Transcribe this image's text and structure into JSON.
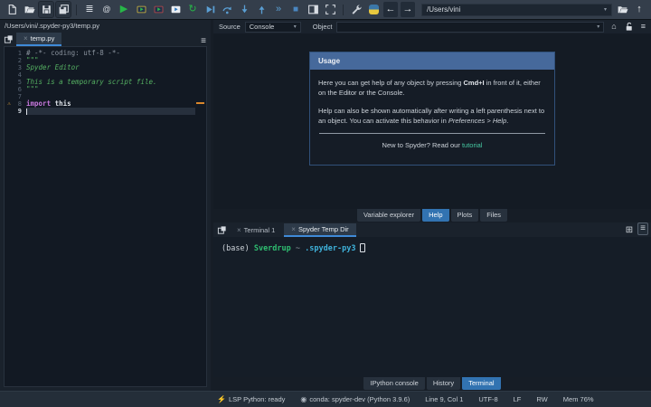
{
  "colors": {
    "accent_blue": "#3273b1",
    "tab_underline_blue": "#3f8ad8",
    "run_green": "#27b648",
    "debug_blue": "#5a9fd4",
    "warning_orange": "#e0a33b",
    "scrollflag_orange": "#d9862c",
    "link_green": "#45c6a0",
    "usage_header_blue": "#46699b",
    "string_green": "#55b062",
    "keyword_purple": "#c678dd"
  },
  "toolbar": {
    "buttons": [
      {
        "name": "new-file-button",
        "icon": "document-icon",
        "svg": "doc"
      },
      {
        "name": "open-file-button",
        "icon": "folder-open-icon",
        "svg": "folder"
      },
      {
        "name": "save-button",
        "icon": "save-icon",
        "svg": "save",
        "boxed": true
      },
      {
        "name": "save-all-button",
        "icon": "save-all-icon",
        "svg": "saveall",
        "boxed": true
      },
      {
        "separator": true
      },
      {
        "name": "outline-button",
        "icon": "outline-icon",
        "glyph": "≣",
        "color": "#d4d9df"
      },
      {
        "name": "find-symbol-button",
        "icon": "at-icon",
        "glyph": "@",
        "color": "#d4d9df",
        "size": "9px"
      },
      {
        "name": "run-file-button",
        "icon": "run-icon",
        "glyph": "▶",
        "color": "#27b648"
      },
      {
        "name": "run-cell-button",
        "icon": "run-cell-icon",
        "svg": "cell"
      },
      {
        "name": "run-cell-advance-button",
        "icon": "run-cell-advance-icon",
        "svg": "cellred"
      },
      {
        "name": "rerun-cell-button",
        "icon": "rerun-cell-icon",
        "svg": "rerun"
      },
      {
        "name": "run-selection-button",
        "icon": "run-selection-icon",
        "glyph": "↻",
        "color": "#27b648"
      },
      {
        "name": "debug-file-button",
        "icon": "debug-play-icon",
        "svg": "debugplay"
      },
      {
        "name": "step-over-button",
        "icon": "step-over-icon",
        "svg": "stepover"
      },
      {
        "name": "step-into-button",
        "icon": "step-into-icon",
        "svg": "stepinto"
      },
      {
        "name": "step-return-button",
        "icon": "step-return-icon",
        "svg": "stepreturn"
      },
      {
        "name": "continue-button",
        "icon": "continue-icon",
        "glyph": "»",
        "color": "#5a9fd4"
      },
      {
        "name": "stop-button",
        "icon": "stop-icon",
        "glyph": "■",
        "color": "#4a86c0",
        "size": "10px"
      },
      {
        "name": "panels-button",
        "icon": "panel-layout-icon",
        "svg": "panel"
      },
      {
        "name": "maximize-pane-button",
        "icon": "maximize-icon",
        "svg": "maximize"
      },
      {
        "separator": true
      },
      {
        "name": "preferences-button",
        "icon": "wrench-icon",
        "svg": "wrench"
      },
      {
        "name": "python-environment-button",
        "icon": "python-logo-icon",
        "svg": "python"
      },
      {
        "name": "back-button",
        "icon": "arrow-left-icon",
        "glyph": "←",
        "color": "#e8ebee",
        "dark": true
      },
      {
        "name": "forward-button",
        "icon": "arrow-right-icon",
        "glyph": "→",
        "color": "#e8ebee",
        "dark": true
      }
    ],
    "cwd_value": "/Users/vini",
    "chevron_glyph": "▾",
    "up_glyph": "↑"
  },
  "editor": {
    "path": "/Users/vini/.spyder-py3/temp.py",
    "tab_label": "temp.py",
    "close_glyph": "×",
    "menu_glyph": "≡",
    "warning_glyph": "⚠",
    "lines": [
      {
        "n": "1",
        "tokens": [
          {
            "t": "# -*- coding: utf-8 -*-",
            "c": "comment"
          }
        ]
      },
      {
        "n": "2",
        "tokens": [
          {
            "t": "\"\"\"",
            "c": "string"
          }
        ]
      },
      {
        "n": "3",
        "tokens": [
          {
            "t": "Spyder Editor",
            "c": "string-italic"
          }
        ]
      },
      {
        "n": "4",
        "tokens": []
      },
      {
        "n": "5",
        "tokens": [
          {
            "t": "This is a temporary script file.",
            "c": "string-italic"
          }
        ]
      },
      {
        "n": "6",
        "tokens": [
          {
            "t": "\"\"\"",
            "c": "string"
          }
        ]
      },
      {
        "n": "7",
        "tokens": []
      },
      {
        "n": "8",
        "warning": true,
        "tokens": [
          {
            "t": "import",
            "c": "keyword"
          },
          {
            "t": " this",
            "c": "plain"
          }
        ]
      },
      {
        "n": "9",
        "current": true,
        "tokens": []
      }
    ]
  },
  "help": {
    "source_label": "Source",
    "source_value": "Console",
    "object_label": "Object",
    "object_value": "",
    "home_glyph": "⌂",
    "menu_glyph": "≡",
    "usage": {
      "title": "Usage",
      "p1_pre": "Here you can get help of any object by pressing ",
      "p1_bold": "Cmd+I",
      "p1_post": " in front of it, either on the Editor or the Console.",
      "p2_pre": "Help can also be shown automatically after writing a left parenthesis next to an object. You can activate this behavior in ",
      "p2_italic": "Preferences > Help",
      "p2_post": ".",
      "footer_pre": "New to Spyder? Read our ",
      "footer_link": "tutorial"
    },
    "tabs": [
      {
        "label": "Variable explorer",
        "active": false
      },
      {
        "label": "Help",
        "active": true
      },
      {
        "label": "Plots",
        "active": false
      },
      {
        "label": "Files",
        "active": false
      }
    ]
  },
  "terminal": {
    "tabs": [
      {
        "label": "Terminal 1",
        "active": false
      },
      {
        "label": "Spyder Temp Dir",
        "active": true
      }
    ],
    "close_glyph": "×",
    "new_terminal_glyph": "⊞",
    "menu_glyph": "≡",
    "prompt_tokens": [
      {
        "t": "(base) ",
        "c": "plain"
      },
      {
        "t": "Sverdrup",
        "c": "green"
      },
      {
        "t": " ~  ",
        "c": "dim"
      },
      {
        "t": ".spyder-py3",
        "c": "cyan"
      }
    ],
    "bottom_tabs": [
      {
        "label": "IPython console",
        "active": false
      },
      {
        "label": "History",
        "active": false
      },
      {
        "label": "Terminal",
        "active": true
      }
    ]
  },
  "statusbar": {
    "items": [
      {
        "name": "lsp-status",
        "icon": "plug-icon",
        "glyph": "⚡",
        "label": "LSP Python: ready"
      },
      {
        "name": "conda-status",
        "icon": "conda-icon",
        "glyph": "◉",
        "label": "conda: spyder-dev (Python 3.9.6)"
      },
      {
        "name": "cursor-position",
        "label": "Line 9, Col 1"
      },
      {
        "name": "encoding-status",
        "label": "UTF-8"
      },
      {
        "name": "eol-status",
        "label": "LF"
      },
      {
        "name": "readwrite-status",
        "label": "RW"
      },
      {
        "name": "memory-usage",
        "label": "Mem 76%"
      }
    ]
  }
}
